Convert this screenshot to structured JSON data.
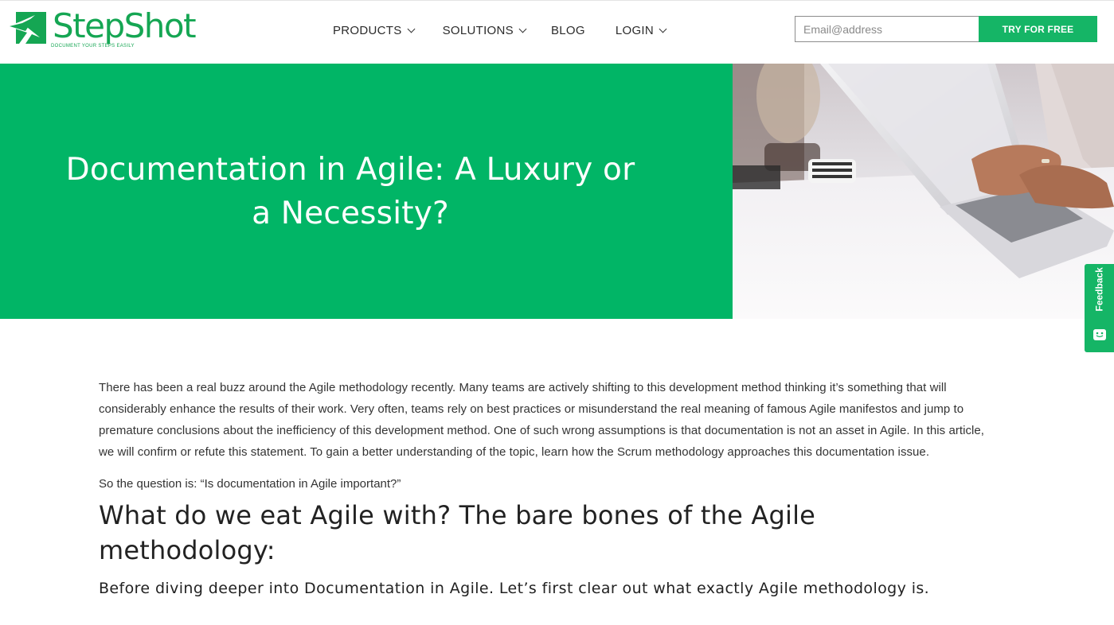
{
  "brand": {
    "name": "StepShot",
    "tagline": "DOCUMENT YOUR STEPS EASILY",
    "color": "#15a653"
  },
  "nav": {
    "items": [
      {
        "label": "PRODUCTS",
        "has_dropdown": true
      },
      {
        "label": "SOLUTIONS",
        "has_dropdown": true
      },
      {
        "label": "BLOG",
        "has_dropdown": false
      },
      {
        "label": "LOGIN",
        "has_dropdown": true
      }
    ]
  },
  "signup": {
    "email_placeholder": "Email@address",
    "email_value": "",
    "button_label": "TRY FOR FREE"
  },
  "hero": {
    "title": "Documentation in Agile: A Luxury or a Necessity?",
    "background_color": "#01b566",
    "image": "person-typing-on-laptop-photo"
  },
  "feedback": {
    "label": "Feedback",
    "icon": "chat-icon"
  },
  "article": {
    "intro": "There has been a real buzz around the Agile methodology recently. Many teams are actively shifting to this development method thinking it’s something that will considerably enhance the results of their work. Very often, teams rely on best practices or misunderstand the real meaning of famous Agile manifestos and jump to premature conclusions about the inefficiency of this development method. One of such wrong assumptions is that documentation is not an asset in Agile. In this article, we will confirm or refute this statement. To gain a better understanding of the topic, learn how the Scrum methodology approaches this documentation issue.",
    "question": "So the question is: “Is documentation in Agile important?”",
    "heading": "What do we eat Agile with? The bare bones of the Agile methodology:",
    "lead": "Before diving deeper into Documentation in Agile. Let’s first clear out what exactly Agile methodology is."
  }
}
